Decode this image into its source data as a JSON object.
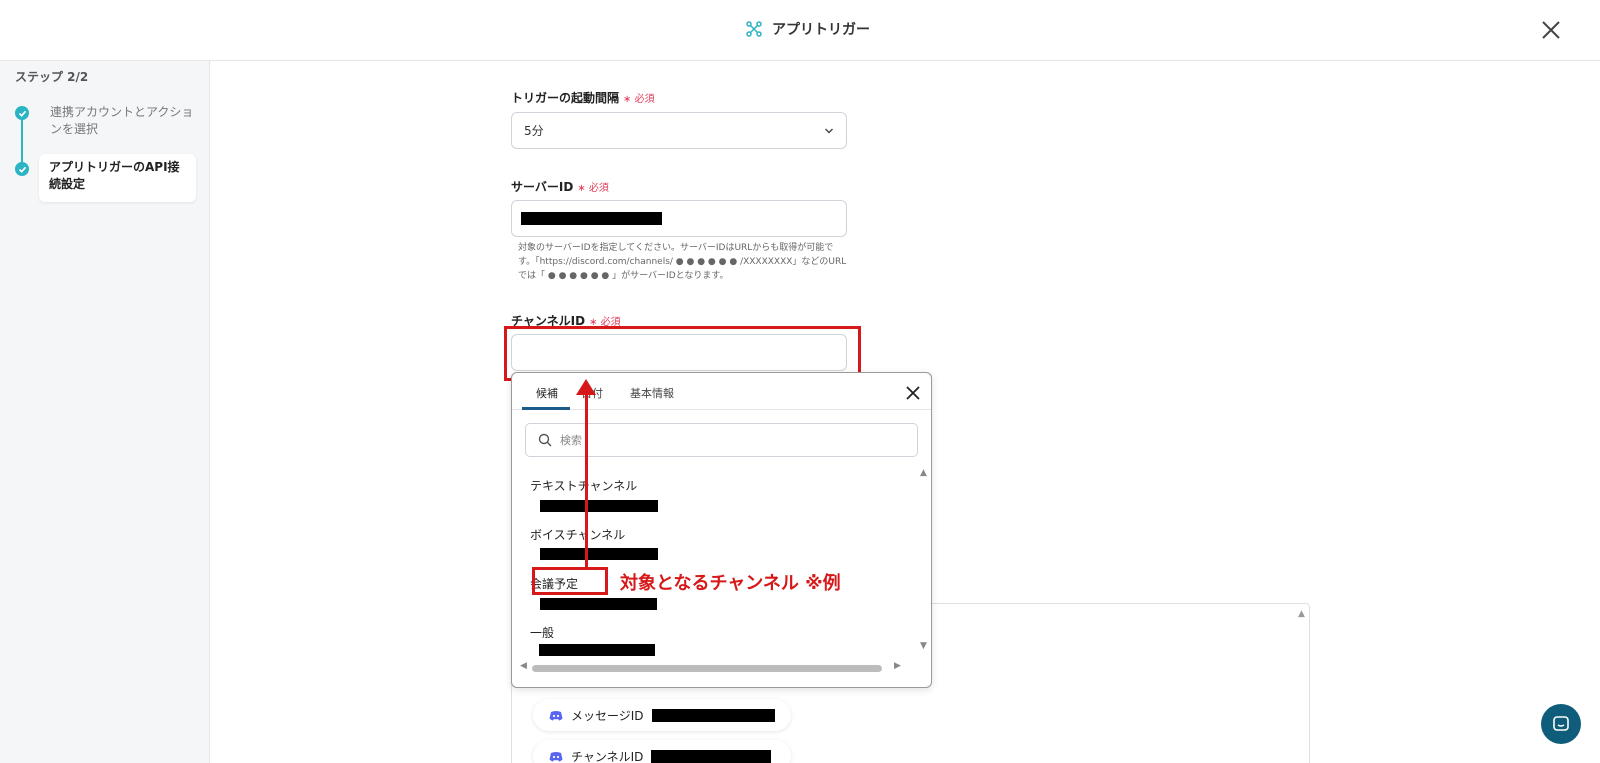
{
  "header": {
    "title": "アプリトリガー",
    "icon": "app-trigger-icon"
  },
  "sidebar": {
    "step_label": "ステップ 2/2",
    "steps": [
      {
        "label": "連携アカウントとアクションを選択",
        "done": true
      },
      {
        "label": "アプリトリガーのAPI接続設定",
        "active": true
      }
    ]
  },
  "form": {
    "interval": {
      "label": "トリガーの起動間隔",
      "required": "必須",
      "value": "5分"
    },
    "server_id": {
      "label": "サーバーID",
      "required": "必須",
      "hint": "対象のサーバーIDを指定してください。サーバーIDはURLからも取得が可能です。「https://discord.com/channels/ ● ● ● ● ● ● /XXXXXXXX」などのURLでは「 ● ● ● ● ● ● 」がサーバーIDとなります。"
    },
    "channel_id": {
      "label": "チャンネルID",
      "required": "必須",
      "value": ""
    }
  },
  "dropdown": {
    "tabs": [
      "候補",
      "日付",
      "基本情報"
    ],
    "active_tab": "候補",
    "search_placeholder": "検索",
    "items": [
      "テキストチャンネル",
      "ボイスチャンネル",
      "会議予定",
      "一般"
    ]
  },
  "annotation": {
    "text": "対象となるチャンネル ※例"
  },
  "outputs": [
    {
      "label": "メッセージID",
      "icon": "discord-icon"
    },
    {
      "label": "チャンネルID",
      "icon": "discord-icon"
    }
  ],
  "colors": {
    "accent": "#2bb4c4",
    "highlight": "#d61818",
    "required": "#e03c5a",
    "help_button": "#0f5d7b",
    "discord": "#5865f2"
  }
}
